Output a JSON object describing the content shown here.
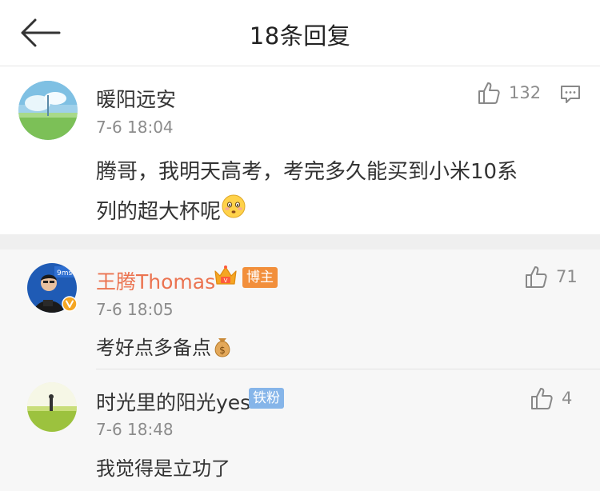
{
  "header": {
    "title": "18条回复",
    "back_icon": "arrow-left-icon"
  },
  "main_comment": {
    "user": "暖阳远安",
    "time": "7-6 18:04",
    "likes": "132",
    "text_line1": "腾哥，我明天高考，考完多久能买到小米10系",
    "text_line2": "列的超大杯呢",
    "emoji": "flushed-face-emoji"
  },
  "replies": [
    {
      "user": "王腾Thomas",
      "badge": "博主",
      "time": "7-6 18:05",
      "likes": "71",
      "text": "考好点多备点",
      "emoji": "money-bag-emoji",
      "verified": true,
      "crown_icon": "crown-icon"
    },
    {
      "user": "时光里的阳光yes",
      "badge": "铁粉",
      "time": "7-6 18:48",
      "likes": "4",
      "text": "我觉得是立功了"
    }
  ],
  "colors": {
    "vip_name": "#eb7350",
    "owner_badge": "#f28f3b",
    "fan_badge": "#86b5e9",
    "muted_text": "#8c8c8c"
  }
}
